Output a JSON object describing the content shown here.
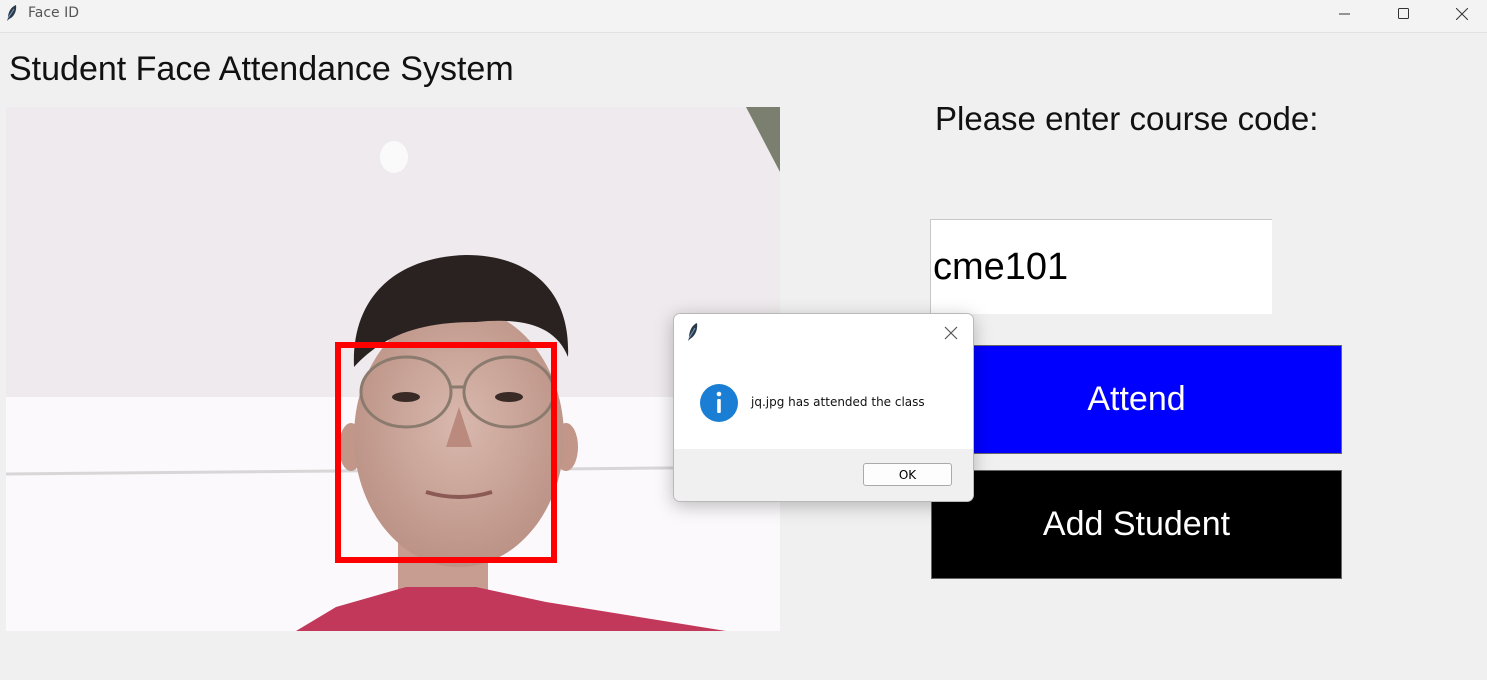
{
  "window": {
    "title": "Face ID",
    "icon": "feather-icon"
  },
  "heading": "Student Face Attendance System",
  "course": {
    "prompt": "Please enter course code:",
    "value": "cme101"
  },
  "buttons": {
    "attend": "Attend",
    "add_student": "Add Student"
  },
  "camera": {
    "detection_color": "#ff0000"
  },
  "dialog": {
    "message": "jq.jpg has attended the class",
    "ok_label": "OK",
    "icon": "info-icon"
  },
  "colors": {
    "attend_bg": "#0000ff",
    "add_student_bg": "#000000"
  }
}
